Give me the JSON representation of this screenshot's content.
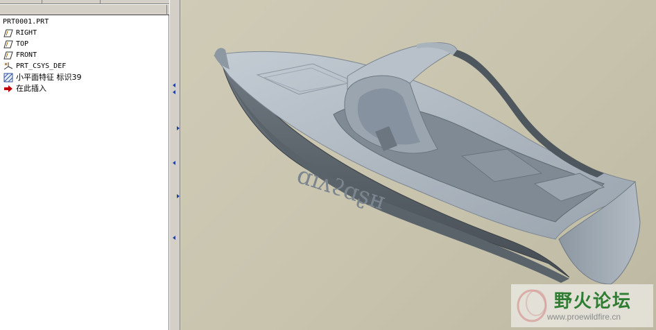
{
  "model_tree": {
    "root_label": "PRT0001.PRT",
    "items": [
      {
        "label": "RIGHT",
        "icon": "datum-plane-icon"
      },
      {
        "label": "TOP",
        "icon": "datum-plane-icon"
      },
      {
        "label": "FRONT",
        "icon": "datum-plane-icon"
      },
      {
        "label": "PRT_CSYS_DEF",
        "icon": "coordinate-system-icon"
      },
      {
        "label": "小平面特征 标识39",
        "icon": "facet-feature-icon"
      },
      {
        "label": "在此插入",
        "icon": "insert-here-arrow-icon"
      }
    ]
  },
  "watermark": {
    "title": "野火论坛",
    "url": "www.proewildfire.cn"
  },
  "colors": {
    "graphics_background": "#c8c4ae",
    "model_shade": "#a7b1bb",
    "insert_arrow": "#c00000",
    "splitter_arrow": "#2040a0"
  }
}
